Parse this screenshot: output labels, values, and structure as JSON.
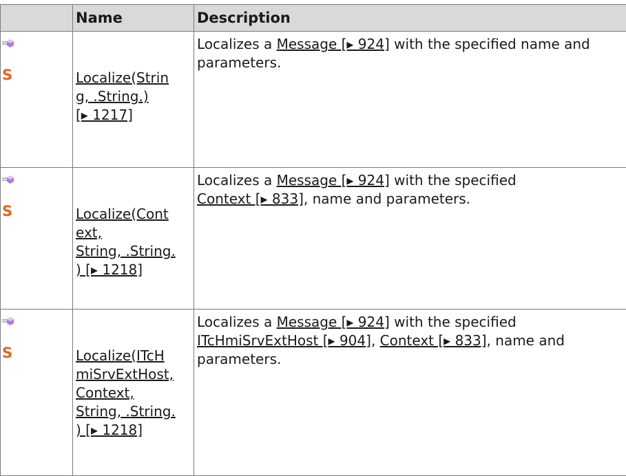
{
  "table": {
    "headers": {
      "icon": "",
      "name": "Name",
      "description": "Description"
    },
    "rows": [
      {
        "name_lines": [
          "Localize(Strin",
          "g, .String.)",
          "[▸ 1217]"
        ],
        "description": {
          "prefix": "Localizes a ",
          "link1": "Message [▸ 924]",
          "suffix": " with the specified name and parameters."
        }
      },
      {
        "name_lines": [
          "Localize(Cont",
          "ext,",
          "String, .String.",
          ") [▸ 1218]"
        ],
        "description": {
          "prefix": "Localizes a ",
          "link1": "Message [▸ 924]",
          "middle": " with the specified ",
          "link2": "Context [▸ 833]",
          "suffix": ", name and parameters."
        }
      },
      {
        "name_lines": [
          "Localize(ITcH",
          "miSrvExtHost,",
          "Context,",
          "String, .String.",
          ") [▸ 1218]"
        ],
        "description": {
          "prefix": "Localizes a ",
          "link1": "Message [▸ 924]",
          "middle": " with the specified ",
          "link2": "ITcHmiSrvExtHost [▸ 904]",
          "sep": ", ",
          "link3": "Context [▸ 833]",
          "suffix": ", name and parameters."
        }
      }
    ],
    "icons": {
      "method": "method-icon",
      "static": "static-icon",
      "static_glyph": "S"
    }
  }
}
